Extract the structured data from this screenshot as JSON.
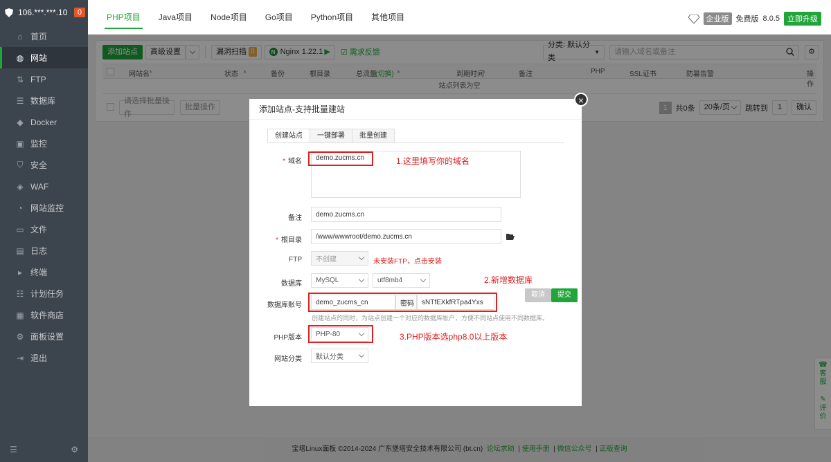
{
  "sidebar": {
    "server_ip": "106.***.***.10",
    "badge": "0",
    "items": [
      {
        "label": "首页",
        "icon": "home-icon",
        "glyph": "⌂"
      },
      {
        "label": "网站",
        "icon": "globe-icon",
        "glyph": "◍",
        "active": true
      },
      {
        "label": "FTP",
        "icon": "ftp-icon",
        "glyph": "⇅"
      },
      {
        "label": "数据库",
        "icon": "database-icon",
        "glyph": "☰"
      },
      {
        "label": "Docker",
        "icon": "docker-icon",
        "glyph": "◆"
      },
      {
        "label": "监控",
        "icon": "monitor-icon",
        "glyph": "▣"
      },
      {
        "label": "安全",
        "icon": "shield-icon",
        "glyph": "⛉"
      },
      {
        "label": "WAF",
        "icon": "waf-icon",
        "glyph": "◈"
      },
      {
        "label": "网站监控",
        "icon": "site-monitor-icon",
        "glyph": "◔"
      },
      {
        "label": "文件",
        "icon": "folder-icon",
        "glyph": "▭"
      },
      {
        "label": "日志",
        "icon": "log-icon",
        "glyph": "▤"
      },
      {
        "label": "终端",
        "icon": "terminal-icon",
        "glyph": "▸"
      },
      {
        "label": "计划任务",
        "icon": "task-icon",
        "glyph": "☷"
      },
      {
        "label": "软件商店",
        "icon": "store-icon",
        "glyph": "▦"
      },
      {
        "label": "面板设置",
        "icon": "gear-icon",
        "glyph": "⚙"
      },
      {
        "label": "退出",
        "icon": "logout-icon",
        "glyph": "⇥"
      }
    ]
  },
  "topbar": {
    "tabs": [
      "PHP项目",
      "Java项目",
      "Node项目",
      "Go项目",
      "Python项目",
      "其他项目"
    ],
    "enterprise": "企业版",
    "free": "免费版",
    "version": "8.0.5",
    "upgrade": "立即升级"
  },
  "toolbar": {
    "add_site": "添加站点",
    "advanced": "高级设置",
    "vuln_scan": "漏洞扫描",
    "vuln_count": "0",
    "nginx": "Nginx 1.22.1",
    "feedback": "需求反馈",
    "category": "分类: 默认分类",
    "search_placeholder": "请输入域名或备注"
  },
  "table": {
    "headers": [
      "网站名",
      "状态",
      "备份",
      "根目录",
      "总流量",
      "(切换)",
      "到期时间",
      "备注",
      "PHP",
      "SSL证书",
      "防篡告警",
      "操作"
    ],
    "empty": "站点列表为空"
  },
  "batch": {
    "placeholder": "请选择批量操作",
    "button": "批量操作"
  },
  "pager": {
    "page": "1",
    "total": "共0条",
    "per_page": "20条/页",
    "goto": "跳转到",
    "goto_page": "1",
    "confirm": "确认"
  },
  "dialog": {
    "title": "添加站点-支持批量建站",
    "tabs": [
      "创建站点",
      "一键部署",
      "批量创建"
    ],
    "domain_label": "域名",
    "domain_value": "demo.zucms.cn",
    "remark_label": "备注",
    "remark_value": "demo.zucms.cn",
    "root_label": "根目录",
    "root_value": "/www/wwwroot/demo.zucms.cn",
    "ftp_label": "FTP",
    "ftp_value": "不创建",
    "ftp_warn": "未安装FTP，点击安装",
    "db_label": "数据库",
    "db_type": "MySQL",
    "db_charset": "utf8mb4",
    "db_account_label": "数据库账号",
    "db_account": "demo_zucms_cn",
    "db_pwd_label": "密码",
    "db_pwd": "sNTfEXkfRTpa4Yxs",
    "db_hint": "创建站点的同时，为站点创建一个对应的数据库帐户，方便不同站点使用不同数据库。",
    "php_label": "PHP版本",
    "php_value": "PHP-80",
    "category_label": "网站分类",
    "category_value": "默认分类",
    "cancel": "取消",
    "submit": "提交"
  },
  "annotations": {
    "a1": "1.这里填写你的域名",
    "a2": "2.新增数据库",
    "a3": "3.PHP版本选php8.0以上版本"
  },
  "footer": {
    "copyright": "宝塔Linux面板 ©2014-2024 广东堡塔安全技术有限公司 (bt.cn)",
    "links": [
      "论坛求助",
      "使用手册",
      "微信公众号",
      "正版查询"
    ]
  },
  "side_widget": {
    "service": "客服",
    "review": "评价"
  },
  "colors": {
    "brand": "#20a53a",
    "sidebar": "#3c444d",
    "annotation": "#e02020"
  }
}
